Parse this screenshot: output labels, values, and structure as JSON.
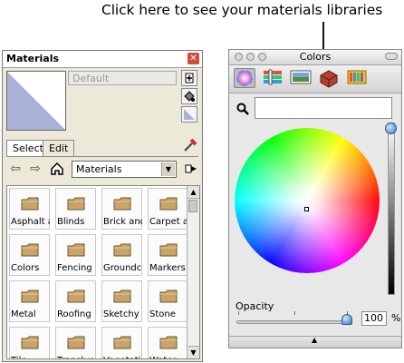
{
  "callout": {
    "text": "Click here to see your materials libraries"
  },
  "materials": {
    "title": "Materials",
    "name_placeholder": "Default",
    "tabs": [
      {
        "label": "Select"
      },
      {
        "label": "Edit"
      }
    ],
    "library": "Materials",
    "items": [
      {
        "label": "Asphalt a"
      },
      {
        "label": "Blinds"
      },
      {
        "label": "Brick and"
      },
      {
        "label": "Carpet a"
      },
      {
        "label": "Colors"
      },
      {
        "label": "Fencing"
      },
      {
        "label": "Groundco"
      },
      {
        "label": "Markers"
      },
      {
        "label": "Metal"
      },
      {
        "label": "Roofing"
      },
      {
        "label": "Sketchy"
      },
      {
        "label": "Stone"
      },
      {
        "label": "Tile"
      },
      {
        "label": "Translucе"
      },
      {
        "label": "Vegetati"
      },
      {
        "label": "Water"
      }
    ],
    "colors": {
      "folder": "#c8a46a",
      "swatch": "#a9b2d6"
    }
  },
  "colors_panel": {
    "title": "Colors",
    "opacity_label": "Opacity",
    "opacity_value": "100",
    "opacity_unit": "%"
  }
}
